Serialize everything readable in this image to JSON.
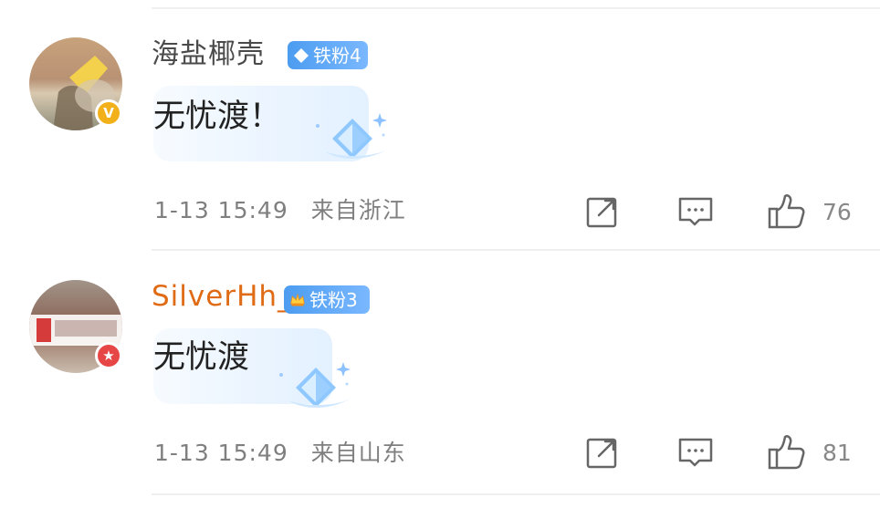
{
  "comments": [
    {
      "username": "海盐椰壳",
      "username_color": "#4a4a4a",
      "fan_badge": "铁粉4",
      "text": "无忧渡！",
      "time": "1-13 15:49",
      "location": "来自浙江",
      "likes": "76",
      "avatar_badge": "V",
      "avatar_badge_color": "#f2b11a",
      "icons": [
        "repost-icon",
        "comment-icon",
        "like-icon"
      ]
    },
    {
      "username": "SilverHh_",
      "username_color": "#e06b15",
      "fan_badge": "铁粉3",
      "text": "无忧渡",
      "time": "1-13 15:49",
      "location": "来自山东",
      "likes": "81",
      "avatar_badge": "★",
      "avatar_badge_color": "#e64646",
      "icons": [
        "repost-icon",
        "comment-icon",
        "like-icon"
      ]
    }
  ]
}
